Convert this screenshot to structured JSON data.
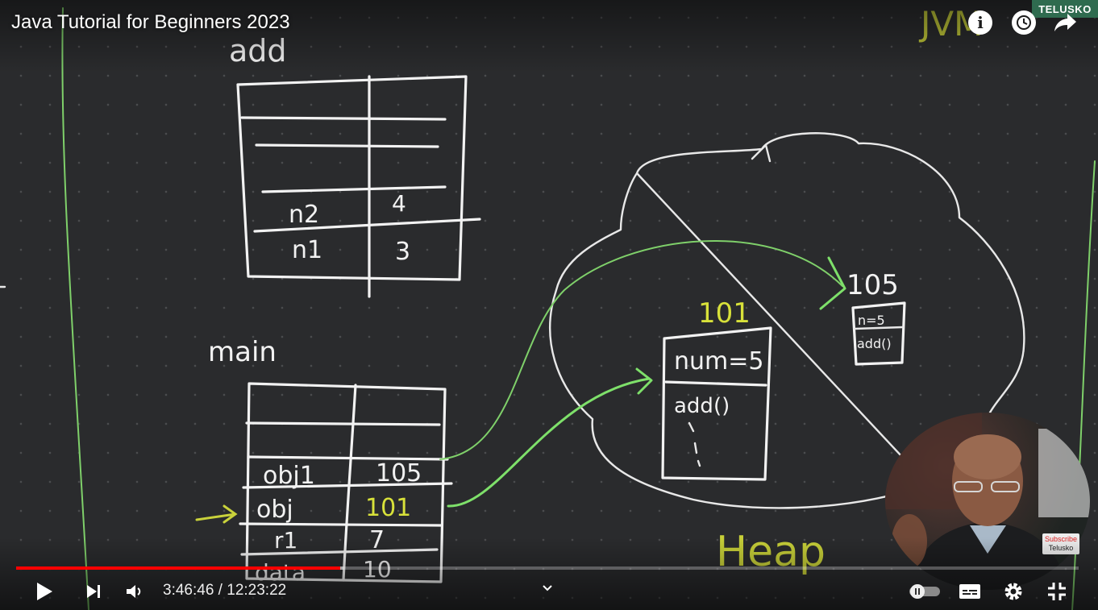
{
  "video": {
    "title": "Java Tutorial for Beginners 2023",
    "channel_badge": "TELUSKO",
    "subscribe_badge_line1": "Subscribe",
    "subscribe_badge_line2": "Telusko"
  },
  "board": {
    "corner_label": "JVM",
    "stack_frame_add": "add",
    "stack_frame_main": "main",
    "add_rows": [
      {
        "name": "n2",
        "value": "4"
      },
      {
        "name": "n1",
        "value": "3"
      }
    ],
    "main_rows": [
      {
        "name": "obj1",
        "value": "105"
      },
      {
        "name": "obj",
        "value": "101"
      },
      {
        "name": "r1",
        "value": "7"
      },
      {
        "name": "data",
        "value": "10"
      }
    ],
    "heap_label": "Heap",
    "object_101": {
      "address": "101",
      "field": "num=5",
      "method": "add()"
    },
    "object_105": {
      "address": "105",
      "field": "n=5",
      "method": "add()"
    }
  },
  "player": {
    "current_time": "3:46:46",
    "separator": " / ",
    "duration": "12:23:22",
    "progress_fraction": 0.305,
    "buffered_fraction": 0.308
  },
  "colors": {
    "progress": "#ff0000",
    "pointer_arrow": "#7ee06a",
    "highlight_yellow": "#d8e13a",
    "badge_green": "#2f6b4f"
  },
  "icons": [
    "info-icon",
    "clock-icon",
    "share-icon",
    "play-icon",
    "next-icon",
    "volume-icon",
    "chevron-down-icon",
    "autoplay-toggle-icon",
    "captions-icon",
    "settings-icon",
    "exit-fullscreen-icon"
  ]
}
